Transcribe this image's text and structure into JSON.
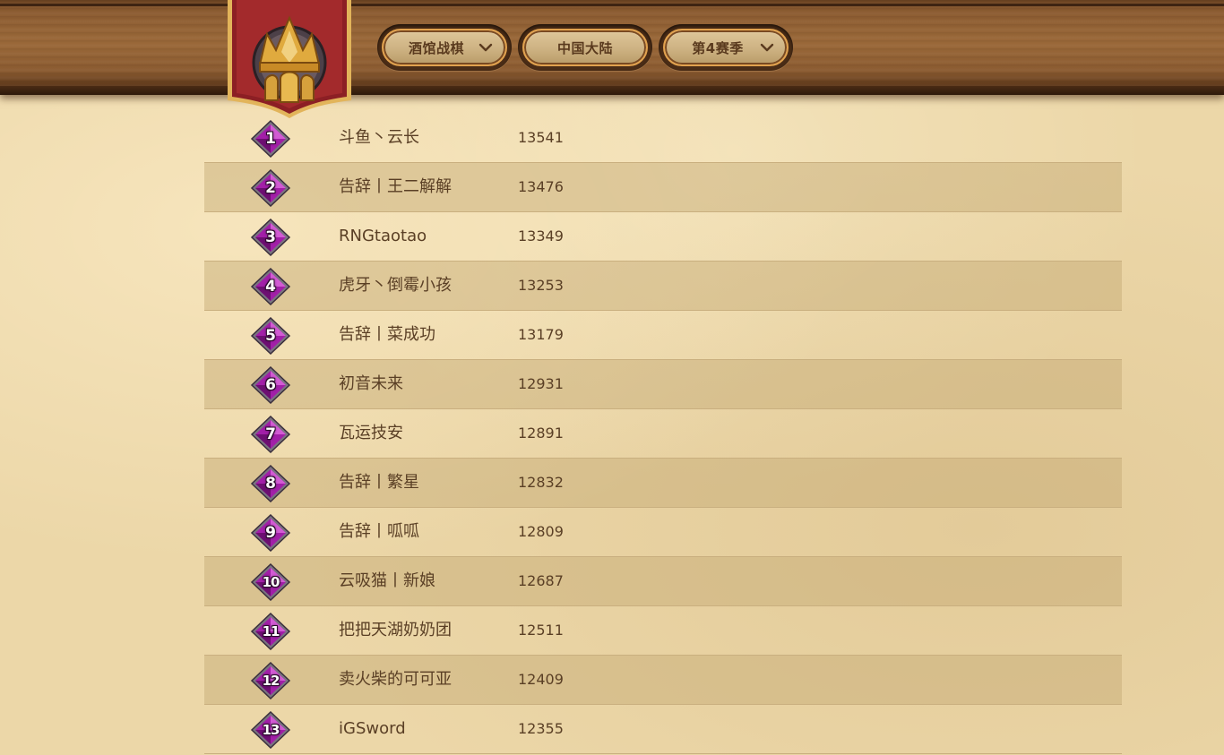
{
  "header": {
    "mode_select": "酒馆战棋",
    "region_button": "中国大陆",
    "season_select": "第4赛季"
  },
  "leaderboard": [
    {
      "rank": "1",
      "name": "斗鱼丶云长",
      "rating": "13541"
    },
    {
      "rank": "2",
      "name": "告辞丨王二解解",
      "rating": "13476"
    },
    {
      "rank": "3",
      "name": "RNGtaotao",
      "rating": "13349"
    },
    {
      "rank": "4",
      "name": "虎牙丶倒霉小孩",
      "rating": "13253"
    },
    {
      "rank": "5",
      "name": "告辞丨菜成功",
      "rating": "13179"
    },
    {
      "rank": "6",
      "name": "初音未来",
      "rating": "12931"
    },
    {
      "rank": "7",
      "name": "瓦运技安",
      "rating": "12891"
    },
    {
      "rank": "8",
      "name": "告辞丨繁星",
      "rating": "12832"
    },
    {
      "rank": "9",
      "name": "告辞丨呱呱",
      "rating": "12809"
    },
    {
      "rank": "10",
      "name": "云吸猫丨新娘",
      "rating": "12687"
    },
    {
      "rank": "11",
      "name": "把把天湖奶奶团",
      "rating": "12511"
    },
    {
      "rank": "12",
      "name": "卖火柴的可可亚",
      "rating": "12409"
    },
    {
      "rank": "13",
      "name": "iGSword",
      "rating": "12355"
    }
  ],
  "colors": {
    "parchment": "#ecd7a8",
    "wood": "#8a5a30",
    "button_border": "#e2a24e",
    "rank_gem": "#9b2a9e",
    "text": "#5a3f25"
  },
  "icons": {
    "dropdown": "chevron-down-icon",
    "rank_badge": "rank-gem-icon",
    "emblem": "crown-emblem-icon"
  }
}
